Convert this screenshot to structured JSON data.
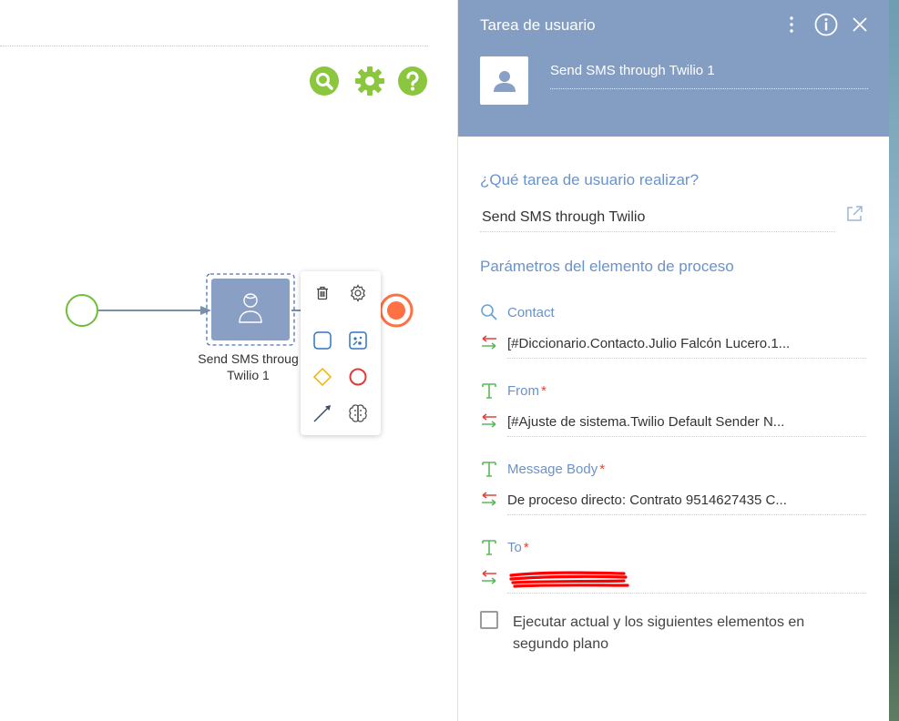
{
  "canvas": {
    "toolbar": {
      "search_icon": "search-icon",
      "settings_icon": "gear-icon",
      "help_icon": "help-icon",
      "accent_color": "#8cc63f"
    },
    "task_node": {
      "label_line1": "Send SMS throug",
      "label_line2": "Twilio 1",
      "fill_color": "#8a9fc4"
    },
    "context_menu": {
      "items": [
        "delete-icon",
        "gear-icon",
        "user-task-icon",
        "script-task-icon",
        "gateway-icon",
        "end-event-icon",
        "connector-arrow-icon",
        "ai-brain-icon"
      ]
    }
  },
  "panel": {
    "header": {
      "title": "Tarea de usuario",
      "element_name": "Send SMS through Twilio 1",
      "background_color": "#849ec3"
    },
    "question_title": "¿Qué tarea de usuario realizar?",
    "task_value": "Send SMS through Twilio",
    "params_title": "Parámetros del elemento de proceso",
    "params": [
      {
        "label": "Contact",
        "required": false,
        "type_icon": "lookup-icon",
        "value": "[#Diccionario.Contacto.Julio Falcón Lucero.1..."
      },
      {
        "label": "From",
        "required": true,
        "type_icon": "text-type-icon",
        "value": "[#Ajuste de sistema.Twilio Default Sender N..."
      },
      {
        "label": "Message Body",
        "required": true,
        "type_icon": "text-type-icon",
        "value": "De proceso directo:  Contrato 9514627435 C..."
      },
      {
        "label": "To",
        "required": true,
        "type_icon": "text-type-icon",
        "value": ""
      }
    ],
    "required_mark": "*",
    "checkbox": {
      "checked": false,
      "label": "Ejecutar actual y los siguientes elementos en segundo plano"
    }
  }
}
